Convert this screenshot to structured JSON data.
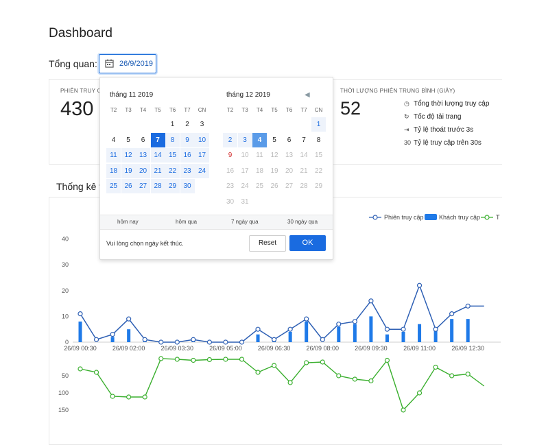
{
  "page": {
    "title": "Dashboard",
    "overview_label": "Tổng quan:"
  },
  "date_input": {
    "value": "26/9/2019",
    "icon": "calendar-icon"
  },
  "stats": {
    "sessions_label": "PHIÊN TRUY C",
    "sessions_value": "430",
    "duration_label": "THỜI LƯỢNG PHIÊN TRUNG BÌNH (GIÂY)",
    "duration_value": "52",
    "metrics": [
      {
        "icon": "clock-icon",
        "label": "Tổng thời lượng truy cập"
      },
      {
        "icon": "refresh-icon",
        "label": "Tốc độ tải trang"
      },
      {
        "icon": "exit-icon",
        "label": "Tỷ lệ thoát trước 3s"
      },
      {
        "icon": "30",
        "label": "Tỷ lệ truy cập trên 30s"
      }
    ]
  },
  "traffic": {
    "heading": "Thống kê t"
  },
  "datepicker": {
    "left_month": "tháng 11 2019",
    "right_month": "tháng 12 2019",
    "weekdays": [
      "T2",
      "T3",
      "T4",
      "T5",
      "T6",
      "T7",
      "CN"
    ],
    "left_days": [
      {
        "d": "1",
        "s": "n"
      },
      {
        "d": "2",
        "s": "n"
      },
      {
        "d": "3",
        "s": "n"
      },
      {
        "d": "4",
        "s": "n"
      },
      {
        "d": "5",
        "s": "n"
      },
      {
        "d": "6",
        "s": "n"
      },
      {
        "d": "7",
        "s": "sel"
      },
      {
        "d": "8",
        "s": "inr"
      },
      {
        "d": "9",
        "s": "inr"
      },
      {
        "d": "10",
        "s": "inr"
      },
      {
        "d": "11",
        "s": "inr"
      },
      {
        "d": "12",
        "s": "inr"
      },
      {
        "d": "13",
        "s": "inr"
      },
      {
        "d": "14",
        "s": "inr"
      },
      {
        "d": "15",
        "s": "inr"
      },
      {
        "d": "16",
        "s": "inr"
      },
      {
        "d": "17",
        "s": "inr"
      },
      {
        "d": "18",
        "s": "inr"
      },
      {
        "d": "19",
        "s": "inr"
      },
      {
        "d": "20",
        "s": "inr"
      },
      {
        "d": "21",
        "s": "inr"
      },
      {
        "d": "22",
        "s": "inr"
      },
      {
        "d": "23",
        "s": "inr"
      },
      {
        "d": "24",
        "s": "inr"
      },
      {
        "d": "25",
        "s": "inr"
      },
      {
        "d": "26",
        "s": "inr"
      },
      {
        "d": "27",
        "s": "inr"
      },
      {
        "d": "28",
        "s": "inr"
      },
      {
        "d": "29",
        "s": "inr"
      },
      {
        "d": "30",
        "s": "inr"
      }
    ],
    "left_start_col": 4,
    "right_days": [
      {
        "d": "1",
        "s": "inr"
      },
      {
        "d": "2",
        "s": "inr"
      },
      {
        "d": "3",
        "s": "inr"
      },
      {
        "d": "4",
        "s": "sel2"
      },
      {
        "d": "5",
        "s": "n"
      },
      {
        "d": "6",
        "s": "n"
      },
      {
        "d": "7",
        "s": "n"
      },
      {
        "d": "8",
        "s": "n"
      },
      {
        "d": "9",
        "s": "red"
      },
      {
        "d": "10",
        "s": "dis"
      },
      {
        "d": "11",
        "s": "dis"
      },
      {
        "d": "12",
        "s": "dis"
      },
      {
        "d": "13",
        "s": "dis"
      },
      {
        "d": "14",
        "s": "dis"
      },
      {
        "d": "15",
        "s": "dis"
      },
      {
        "d": "16",
        "s": "dis"
      },
      {
        "d": "17",
        "s": "dis"
      },
      {
        "d": "18",
        "s": "dis"
      },
      {
        "d": "19",
        "s": "dis"
      },
      {
        "d": "20",
        "s": "dis"
      },
      {
        "d": "21",
        "s": "dis"
      },
      {
        "d": "22",
        "s": "dis"
      },
      {
        "d": "23",
        "s": "dis"
      },
      {
        "d": "24",
        "s": "dis"
      },
      {
        "d": "25",
        "s": "dis"
      },
      {
        "d": "26",
        "s": "dis"
      },
      {
        "d": "27",
        "s": "dis"
      },
      {
        "d": "28",
        "s": "dis"
      },
      {
        "d": "29",
        "s": "dis"
      },
      {
        "d": "30",
        "s": "dis"
      },
      {
        "d": "31",
        "s": "dis"
      }
    ],
    "right_start_col": 6,
    "quick_ranges": [
      "hôm nay",
      "hôm qua",
      "7 ngày qua",
      "30 ngày qua"
    ],
    "hint": "Vui lòng chọn ngày kết thúc.",
    "reset_label": "Reset",
    "ok_label": "OK",
    "prev_icon": "triangle-left-icon"
  },
  "colors": {
    "accent": "#1a6be0",
    "line_blue": "#2d5fb4",
    "bar_blue": "#1f7ae8",
    "line_green": "#3aaf2e"
  },
  "chart_data": {
    "type": "line",
    "legend": [
      "Phiên truy cập",
      "Khách truy cập",
      "T"
    ],
    "x_tick_labels": [
      "26/09 00:30",
      "26/09 02:00",
      "26/09 03:30",
      "26/09 05:00",
      "26/09 06:30",
      "26/09 08:00",
      "26/09 09:30",
      "26/09 11:00",
      "26/09 12:30"
    ],
    "upper_axis": {
      "ticks": [
        0,
        10,
        20,
        30,
        40
      ],
      "ylim": [
        0,
        40
      ]
    },
    "lower_axis": {
      "ticks": [
        50,
        100,
        150
      ],
      "ylim": [
        0,
        150
      ],
      "inverted": true
    },
    "series": [
      {
        "name": "Phiên truy cập",
        "kind": "line",
        "values": [
          11,
          1,
          3,
          9,
          1,
          0,
          0,
          1,
          0,
          0,
          0,
          5,
          1,
          5,
          9,
          1,
          7,
          8,
          16,
          5,
          5,
          22,
          5,
          11,
          14,
          14
        ]
      },
      {
        "name": "Khách truy cập",
        "kind": "bar",
        "values": [
          8,
          0,
          2,
          5,
          1,
          0,
          0,
          1,
          0,
          0,
          0,
          3,
          1,
          4,
          8,
          0,
          6,
          7,
          10,
          3,
          4,
          7,
          5,
          9,
          9,
          0
        ]
      },
      {
        "name": "T",
        "kind": "line",
        "values": [
          30,
          40,
          110,
          112,
          112,
          0,
          2,
          5,
          3,
          2,
          2,
          40,
          20,
          70,
          12,
          10,
          50,
          60,
          65,
          5,
          150,
          100,
          25,
          50,
          45,
          80
        ]
      }
    ]
  }
}
